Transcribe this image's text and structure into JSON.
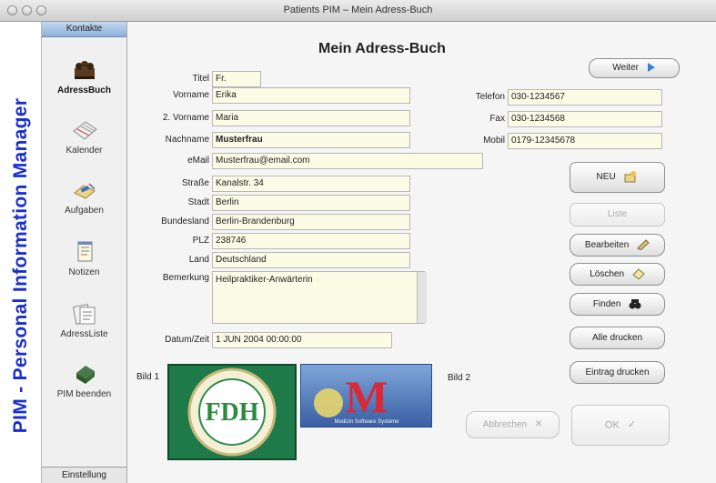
{
  "window": {
    "title": "Patients PIM – Mein Adress-Buch"
  },
  "brand": {
    "vertical_title": "PIM - Personal Information Manager"
  },
  "sidebar": {
    "header": "Kontakte",
    "footer": "Einstellung",
    "items": [
      {
        "label": "AdressBuch",
        "icon": "address-book-icon",
        "active": true
      },
      {
        "label": "Kalender",
        "icon": "calendar-icon",
        "active": false
      },
      {
        "label": "Aufgaben",
        "icon": "tasks-icon",
        "active": false
      },
      {
        "label": "Notizen",
        "icon": "notes-icon",
        "active": false
      },
      {
        "label": "AdressListe",
        "icon": "address-list-icon",
        "active": false
      },
      {
        "label": "PIM beenden",
        "icon": "quit-icon",
        "active": false
      }
    ]
  },
  "form": {
    "page_title": "Mein Adress-Buch",
    "titel": {
      "label": "Titel",
      "value": "Fr."
    },
    "vorname": {
      "label": "Vorname",
      "value": "Erika"
    },
    "vorname2": {
      "label": "2. Vorname",
      "value": "Maria"
    },
    "nachname": {
      "label": "Nachname",
      "value": "Musterfrau"
    },
    "email": {
      "label": "eMail",
      "value": "Musterfrau@email.com"
    },
    "strasse": {
      "label": "Straße",
      "value": "Kanalstr. 34"
    },
    "stadt": {
      "label": "Stadt",
      "value": "Berlin"
    },
    "bundesland": {
      "label": "Bundesland",
      "value": "Berlin-Brandenburg"
    },
    "plz": {
      "label": "PLZ",
      "value": "238746"
    },
    "land": {
      "label": "Land",
      "value": "Deutschland"
    },
    "bemerkung": {
      "label": "Bemerkung",
      "value": "Heilpraktiker-Anwärterin"
    },
    "datum": {
      "label": "Datum/Zeit",
      "value": "1 JUN 2004  00:00:00"
    },
    "telefon": {
      "label": "Telefon",
      "value": "030-1234567"
    },
    "fax": {
      "label": "Fax",
      "value": "030-1234568"
    },
    "mobil": {
      "label": "Mobil",
      "value": "0179-12345678"
    }
  },
  "images": {
    "bild1_label": "Bild 1",
    "bild2_label": "Bild 2",
    "logo1_text": "FDH",
    "logo2_text": "M",
    "logo2_caption": "Medizin Software Systeme"
  },
  "buttons": {
    "weiter": "Weiter",
    "neu": "NEU",
    "liste": "Liste",
    "bearbeiten": "Bearbeiten",
    "loeschen": "Löschen",
    "finden": "Finden",
    "alle_drucken": "Alle drucken",
    "eintrag_drucken": "Eintrag drucken",
    "abbrechen": "Abbrechen",
    "ok": "OK"
  },
  "colors": {
    "vertical_title": "#1a2fd0",
    "field_bg": "#fbfbe6",
    "sidebar_header": "#9fbde3"
  }
}
